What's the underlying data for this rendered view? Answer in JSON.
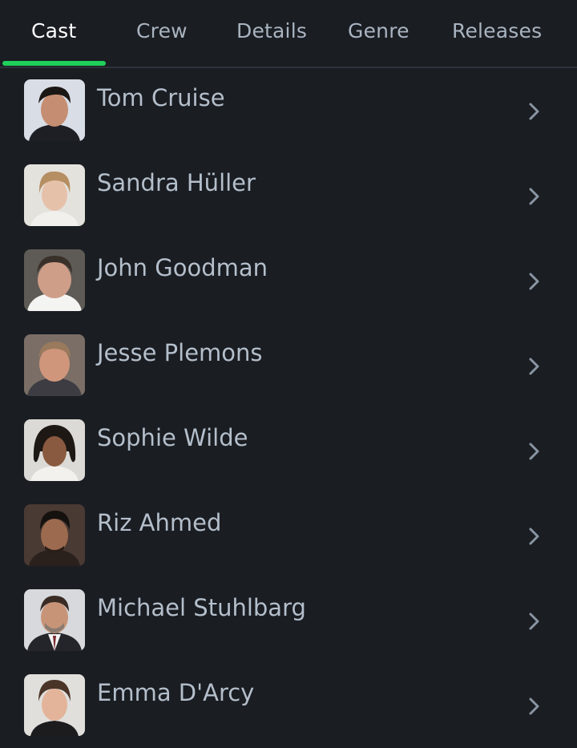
{
  "tabs": [
    {
      "label": "Cast",
      "active": true
    },
    {
      "label": "Crew"
    },
    {
      "label": "Details"
    },
    {
      "label": "Genre"
    },
    {
      "label": "Releases"
    }
  ],
  "accent_color": "#1fd05b",
  "cast": [
    {
      "name": "Tom Cruise",
      "avatar_icon": "actor-photo"
    },
    {
      "name": "Sandra Hüller",
      "avatar_icon": "actor-photo"
    },
    {
      "name": "John Goodman",
      "avatar_icon": "actor-photo"
    },
    {
      "name": "Jesse Plemons",
      "avatar_icon": "actor-photo"
    },
    {
      "name": "Sophie Wilde",
      "avatar_icon": "actor-photo"
    },
    {
      "name": "Riz Ahmed",
      "avatar_icon": "actor-photo"
    },
    {
      "name": "Michael Stuhlbarg",
      "avatar_icon": "actor-photo"
    },
    {
      "name": "Emma D'Arcy",
      "avatar_icon": "actor-photo"
    }
  ],
  "row_action_icon": "chevron-right-icon"
}
